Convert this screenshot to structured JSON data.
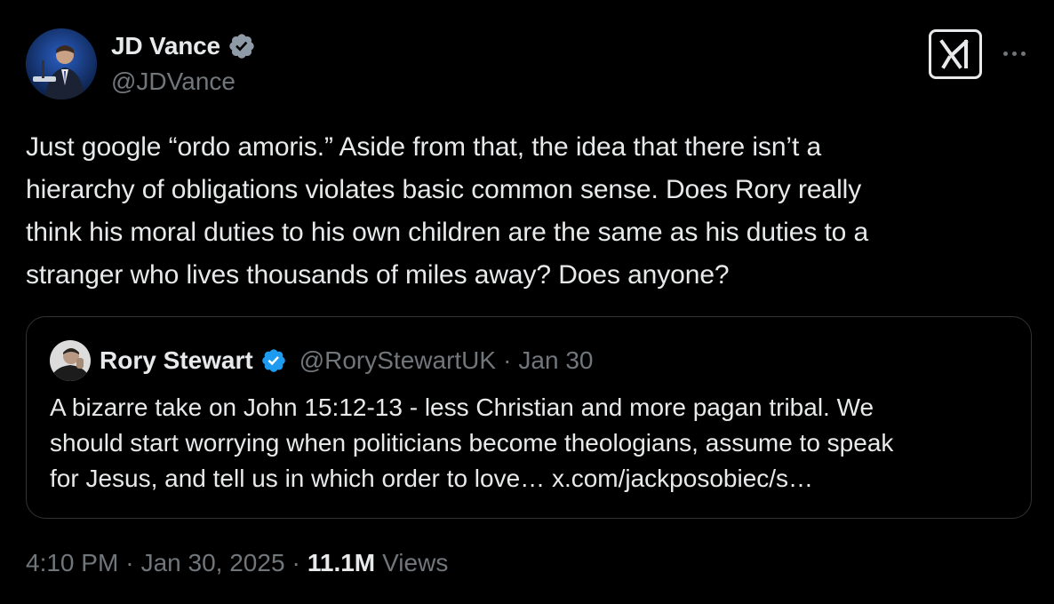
{
  "author": {
    "display_name": "JD Vance",
    "handle": "@JDVance",
    "verified_icon": "verified-badge-icon"
  },
  "header_actions": {
    "grok_icon": "grok-logo-icon",
    "more_icon": "more-options-icon"
  },
  "tweet": {
    "text_lines": [
      "Just google “ordo amoris.” Aside from that, the idea that there isn’t a",
      "hierarchy of obligations violates basic common sense. Does Rory really",
      "think his moral duties to his own children are the same as his duties to a",
      "stranger who lives thousands of miles away? Does anyone?"
    ]
  },
  "quote": {
    "display_name": "Rory Stewart",
    "handle": "@RoryStewartUK",
    "separator": "·",
    "date": "Jan 30",
    "text_lines": [
      "A bizarre take on John 15:12-13  - less Christian and more pagan tribal. We",
      "should start worrying when politicians become theologians, assume to speak",
      "for Jesus, and tell us in which order to love…"
    ],
    "link_text": "x.com/jackposobiec/s…"
  },
  "meta": {
    "time": "4:10 PM",
    "date": "Jan 30, 2025",
    "separator": "·",
    "views_count": "11.1M",
    "views_label": "Views"
  },
  "colors": {
    "background": "#000000",
    "text_primary": "#e7e9ea",
    "text_secondary": "#71767b",
    "border": "#2f3336",
    "verified": "#8e9aa6"
  }
}
